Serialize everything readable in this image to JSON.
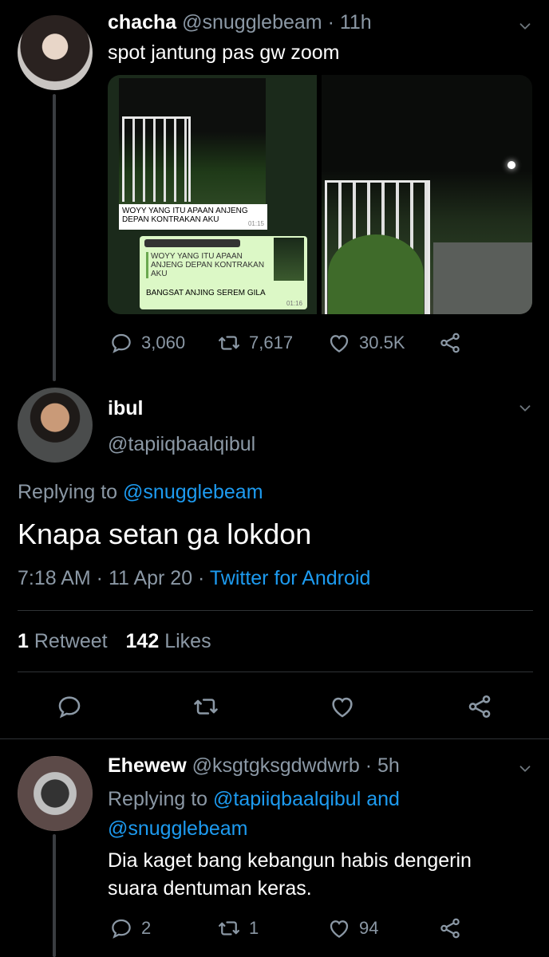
{
  "tweet1": {
    "name": "chacha",
    "handle": "@snugglebeam",
    "time": "· 11h",
    "text": "spot jantung pas gw zoom",
    "chat": {
      "msg1_text": "WOYY YANG ITU APAAN ANJENG DEPAN KONTRAKAN AKU",
      "msg1_time": "01:15",
      "quote_text": "WOYY YANG ITU APAAN ANJENG DEPAN KONTRAKAN AKU",
      "reply_text": "BANGSAT ANJING SEREM GILA",
      "reply_time": "01:16"
    },
    "replies": "3,060",
    "retweets": "7,617",
    "likes": "30.5K"
  },
  "tweet2": {
    "name": "ibul",
    "handle": "@tapiiqbaalqibul",
    "replying_prefix": "Replying to",
    "replying_to": "@snugglebeam",
    "text": "Knapa setan ga lokdon",
    "time": "7:18 AM · 11 Apr 20 · ",
    "source": "Twitter for Android",
    "retweet_count": "1",
    "retweet_label": "Retweet",
    "like_count": "142",
    "like_label": "Likes"
  },
  "tweet3": {
    "name": "Ehewew",
    "handle": "@ksgtgksgdwdwrb",
    "time": "· 5h",
    "replying_prefix": "Replying to",
    "replying_to_1": "@tapiiqbaalqibul",
    "replying_and": "and",
    "replying_to_2": "@snugglebeam",
    "text_line1": "Dia kaget bang kebangun habis dengerin",
    "text_line2": "suara dentuman keras.",
    "replies": "2",
    "retweets": "1",
    "likes": "94"
  },
  "colors": {
    "background": "#000000",
    "secondary_text": "#8b98a5",
    "link": "#1d9bf0",
    "divider": "#2f3336"
  }
}
